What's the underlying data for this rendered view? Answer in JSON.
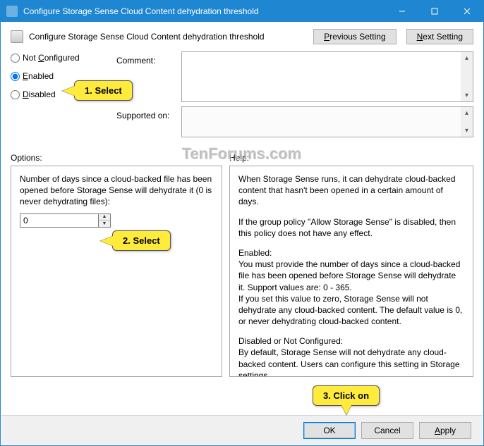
{
  "titlebar": {
    "title": "Configure Storage Sense Cloud Content dehydration threshold"
  },
  "header": {
    "subtitle": "Configure Storage Sense Cloud Content dehydration threshold",
    "prev_btn": "Previous Setting",
    "next_btn": "Next Setting"
  },
  "radios": {
    "not_configured": "Not Configured",
    "enabled": "Enabled",
    "disabled": "Disabled",
    "selected": "enabled"
  },
  "fields": {
    "comment_label": "Comment:",
    "comment_value": "",
    "supported_label": "Supported on:",
    "supported_value": ""
  },
  "labels": {
    "options": "Options:",
    "help": "Help:"
  },
  "options": {
    "desc": "Number of days since a cloud-backed file has been opened before Storage Sense will dehydrate it (0 is never dehydrating files):",
    "value": "0"
  },
  "help": {
    "p1": "When Storage Sense runs, it can dehydrate cloud-backed content that hasn't been opened in a certain amount of days.",
    "p2": "If the group policy \"Allow Storage Sense\" is disabled, then this policy does not have any effect.",
    "p3h": "Enabled:",
    "p3": "You must provide the number of days since a cloud-backed file has been opened before Storage Sense will dehydrate it. Support values are: 0 - 365.",
    "p3b": "If you set this value to zero, Storage Sense will not dehydrate any cloud-backed content. The default value is 0, or never dehydrating cloud-backed content.",
    "p4h": "Disabled or Not Configured:",
    "p4": "By default, Storage Sense will not dehydrate any cloud-backed content. Users can configure this setting in Storage settings."
  },
  "buttons": {
    "ok": "OK",
    "cancel": "Cancel",
    "apply": "Apply"
  },
  "callouts": {
    "c1": "1. Select",
    "c2": "2. Select",
    "c3": "3. Click on"
  },
  "watermark": "TenForums.com"
}
